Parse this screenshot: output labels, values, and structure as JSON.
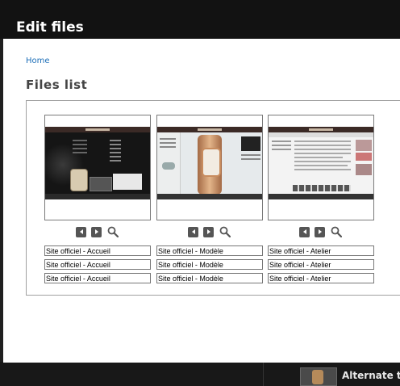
{
  "modal": {
    "title": "Edit files",
    "breadcrumb": "Home",
    "heading": "Files list"
  },
  "files": [
    {
      "preview": "homepage-screenshot",
      "titles": [
        "Site officiel - Accueil",
        "Site officiel - Accueil",
        "Site officiel - Accueil"
      ]
    },
    {
      "preview": "watch-model-screenshot",
      "titles": [
        "Site officiel - Modèle",
        "Site officiel - Modèle",
        "Site officiel - Modèle"
      ]
    },
    {
      "preview": "atelier-page-screenshot",
      "titles": [
        "Site officiel - Atelier",
        "Site officiel - Atelier",
        "Site officiel - Atelier"
      ]
    }
  ],
  "controls": {
    "prev_icon": "arrow-left-icon",
    "next_icon": "arrow-right-icon",
    "zoom_icon": "magnifier-icon"
  },
  "background": {
    "snippet_text": "Alternate tex"
  },
  "colors": {
    "overlay": "#1f1f1f",
    "modal_bg": "#ffffff",
    "link": "#1d6fb8",
    "heading": "#444444"
  }
}
